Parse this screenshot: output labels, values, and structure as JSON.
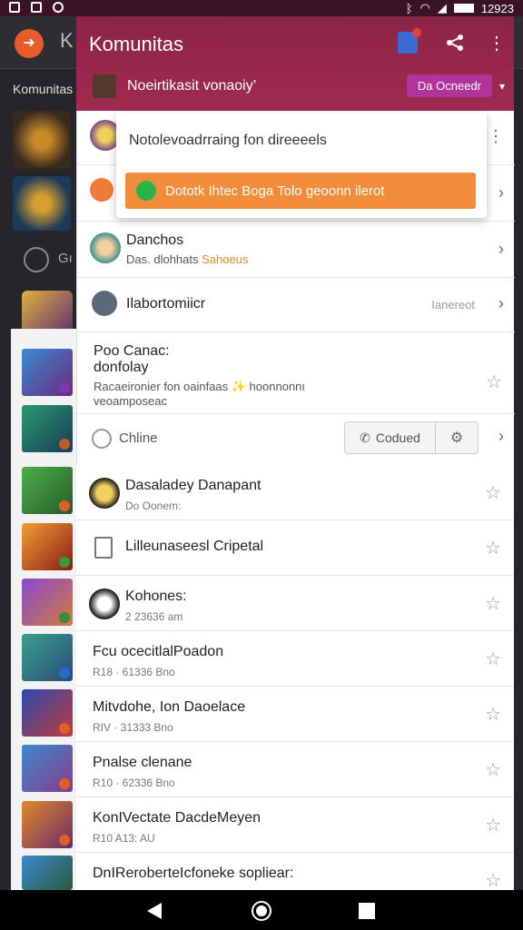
{
  "status_bar": {
    "time": "12923"
  },
  "background": {
    "header_letter": "K",
    "section_label": "Komunitas",
    "group_label": "Gı"
  },
  "appbar": {
    "title": "Komunitas",
    "subtitle": "Noeirtikasit vonaoiy’",
    "join_label": "Da Ocneedr",
    "colors": {
      "start": "#8c2446",
      "end": "#a02a50"
    }
  },
  "popup": {
    "text": "Notolevoadrraing fon direeeels",
    "button_label": "Dototk Ihtec Boga Tolo geoonn ilerot"
  },
  "card": {
    "rows": [
      {
        "title": "Danchos",
        "subtitle": "Das. dlohhats",
        "highlight": "Sahoeus"
      },
      {
        "title": "Ilabortomiicr",
        "meta": "Ianereot"
      }
    ],
    "post": {
      "title_line1": "Poo Canac:",
      "title_line2": "donfolay",
      "desc_line1": "Racaeironier fon oainfaas ✨ hoonnonnı",
      "desc_line2": "veoamposeac"
    },
    "online_label": "Chline",
    "call_label": "Codued"
  },
  "list": [
    {
      "title": "Dasaladey Danapant",
      "subtitle": "Do Oonem:",
      "icon": "avatar-icon"
    },
    {
      "title": "Lilleunaseesl Cripetal",
      "subtitle": "",
      "icon": "document-icon"
    },
    {
      "title": "Kohones:",
      "subtitle": "2 23636 am",
      "icon": "avatar-icon"
    },
    {
      "title": "Fcu ocecitlalPoadon",
      "subtitle": "R18 · 61336 Bno",
      "icon": ""
    },
    {
      "title": "Mitvdohe, Ion Daoelace",
      "subtitle": "RIV · 31333 Bno",
      "icon": ""
    },
    {
      "title": "Pnalse clenane",
      "subtitle": "R10 · 62336 Bno",
      "icon": ""
    },
    {
      "title": "KonIVectate DacdeMeyen",
      "subtitle": "R10 A13: AU",
      "icon": ""
    },
    {
      "title": "DnIReroberteIcfoneke sopliear:",
      "subtitle": "",
      "icon": ""
    }
  ],
  "navbar": {
    "icons": [
      "back-icon",
      "home-icon",
      "recents-icon"
    ]
  }
}
